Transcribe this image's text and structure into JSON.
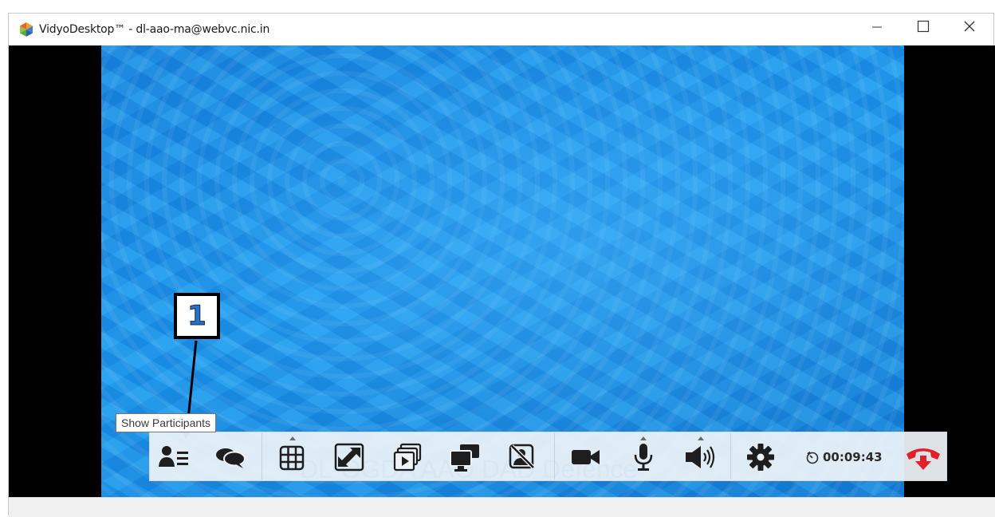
{
  "window": {
    "title": "VidyoDesktop™ - dl-aao-ma@webvc.nic.in",
    "app_icon": "vidyo-logo-icon",
    "controls": [
      "minimize-icon",
      "maximize-icon",
      "close-icon"
    ]
  },
  "annotation": {
    "number": "1"
  },
  "tooltip": {
    "text": "Show Participants"
  },
  "call": {
    "room_name": "DL-OGDA AAO DAD Defence",
    "timer": "00:09:43"
  },
  "toolbar": {
    "buttons": [
      {
        "name": "show-participants",
        "icon": "participants-icon"
      },
      {
        "name": "chat",
        "icon": "chat-bubbles-icon"
      },
      {
        "name": "layout",
        "icon": "grid-layout-icon",
        "has_menu": true
      },
      {
        "name": "fullscreen",
        "icon": "expand-arrows-icon"
      },
      {
        "name": "self-view",
        "icon": "stacked-windows-icon"
      },
      {
        "name": "share",
        "icon": "monitor-share-icon"
      },
      {
        "name": "privacy",
        "icon": "privacy-off-icon"
      },
      {
        "name": "camera",
        "icon": "video-camera-icon"
      },
      {
        "name": "microphone",
        "icon": "microphone-icon",
        "has_menu": true
      },
      {
        "name": "speaker",
        "icon": "speaker-icon",
        "has_menu": true
      },
      {
        "name": "settings",
        "icon": "gear-icon"
      },
      {
        "name": "hang-up",
        "icon": "phone-hangup-icon"
      }
    ]
  },
  "colors": {
    "video_blue": "#1e9bef",
    "hangup_red": "#e0202a",
    "annotation_blue": "#2a6fc4"
  }
}
